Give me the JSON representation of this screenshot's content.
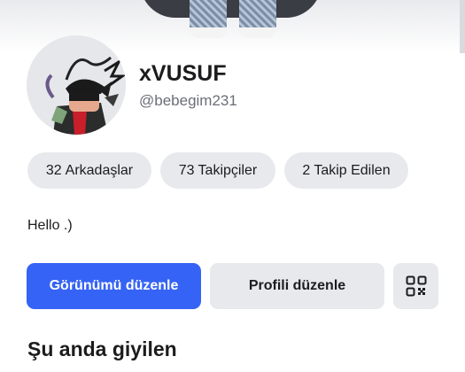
{
  "profile": {
    "display_name": "xVUSUF",
    "handle": "@bebegim231",
    "bio": "Hello .)"
  },
  "stats": [
    {
      "count": "32",
      "label": "Arkadaşlar"
    },
    {
      "count": "73",
      "label": "Takipçiler"
    },
    {
      "count": "2",
      "label": "Takip Edilen"
    }
  ],
  "actions": {
    "edit_look_label": "Görünümü düzenle",
    "edit_profile_label": "Profili düzenle",
    "qr_icon": "qr-code-icon"
  },
  "sections": {
    "currently_wearing": "Şu anda giyilen"
  },
  "colors": {
    "accent": "#3563f5",
    "chip_bg": "#e8e9ec",
    "text_primary": "#1c1c1e",
    "text_secondary": "#6b6e75"
  }
}
